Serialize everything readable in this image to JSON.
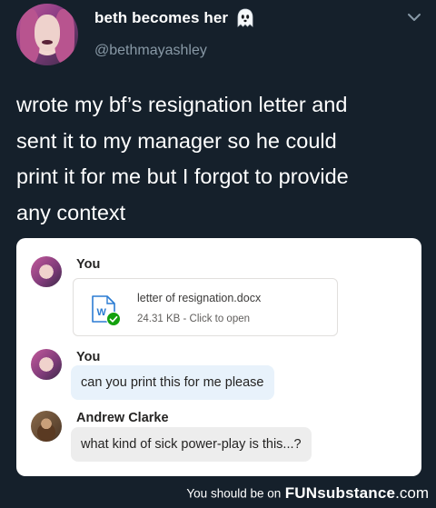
{
  "tweet": {
    "display_name": "beth becomes her",
    "handle": "@bethmayashley",
    "text_lines": [
      "wrote my bf’s resignation letter and",
      "sent it to my manager so he could",
      "print it for me but I forgot to provide",
      "any context"
    ]
  },
  "chat": {
    "messages": [
      {
        "sender": "You",
        "file": {
          "name": "letter of resignation.docx",
          "meta": "24.31 KB - Click to open"
        }
      },
      {
        "sender": "You",
        "text": "can you print this for me please"
      },
      {
        "sender": "Andrew Clarke",
        "text": "what kind of sick power-play is this...?"
      }
    ]
  },
  "footer": {
    "prefix": "You should be on",
    "brand_bold": "FUNsubstance",
    "brand_suffix": ".com"
  },
  "colors": {
    "background": "#15202b",
    "muted": "#8899a6",
    "word_blue": "#2b7cd3",
    "check_green": "#13a10e",
    "my_bubble": "#e8f2fb",
    "their_bubble": "#ededed"
  },
  "icons": [
    "ghost-icon",
    "chevron-down-icon",
    "word-file-icon",
    "check-icon"
  ]
}
